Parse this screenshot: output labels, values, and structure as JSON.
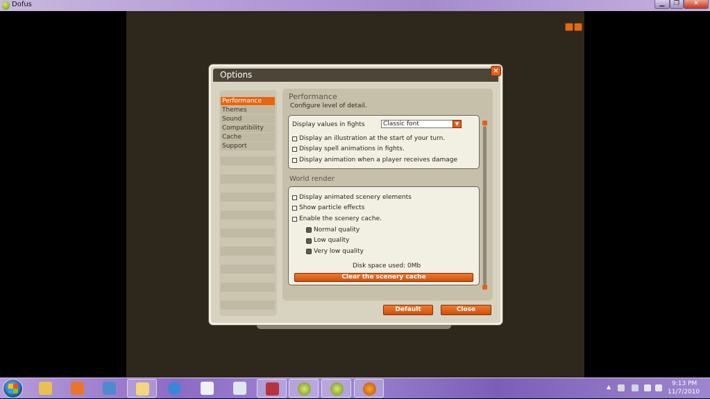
{
  "window": {
    "title": "Dofus",
    "minimize": "▁",
    "maximize": "❐",
    "close": "✕"
  },
  "dialog": {
    "title": "Options",
    "close": "×",
    "sidebar": [
      "Performance",
      "Themes",
      "Sound",
      "Compatibility",
      "Cache",
      "Support"
    ],
    "section_title": "Performance",
    "section_subtitle": "Configure level of detail.",
    "fight_display": {
      "label": "Display values in fights",
      "select_value": "Classic font",
      "options": [
        "Display an illustration at the start of your turn.",
        "Display spell animations in fights.",
        "Display animation when a player receives damage"
      ]
    },
    "world_render": {
      "title": "World render",
      "options": [
        "Display animated scenery elements",
        "Show particle effects",
        "Enable the scenery cache."
      ],
      "qualities": [
        "Normal quality",
        "Low quality",
        "Very low quality"
      ],
      "disk_space": "Disk space used: 0Mb",
      "clear_button": "Clear the scenery cache"
    },
    "default_button": "Default",
    "close_button": "Close"
  },
  "taskbar": {
    "apps": [
      "start-button",
      "explorer",
      "media-player",
      "paint",
      "folder",
      "internet-explorer",
      "document",
      "editor",
      "winrar",
      "dofus",
      "dofus",
      "firefox"
    ],
    "clock_time": "9:13 PM",
    "clock_date": "11/7/2010"
  },
  "colors": {
    "accent": "#e2601a",
    "panel": "#f2efe3",
    "dialog": "#d8d2c0",
    "game_bg": "#2e271c"
  }
}
